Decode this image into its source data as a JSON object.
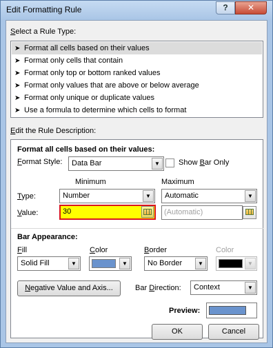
{
  "window": {
    "title": "Edit Formatting Rule",
    "help_label": "?",
    "close_label": "✕"
  },
  "rule_type": {
    "heading_prefix": "S",
    "heading_rest": "elect a Rule Type:",
    "arrow": "➤",
    "items": [
      "Format all cells based on their values",
      "Format only cells that contain",
      "Format only top or bottom ranked values",
      "Format only values that are above or below average",
      "Format only unique or duplicate values",
      "Use a formula to determine which cells to format"
    ],
    "selected_index": 0
  },
  "description": {
    "heading_prefix": "E",
    "heading_rest": "dit the Rule Description:",
    "subheading": "Format all cells based on their values:",
    "format_style_label_prefix": "F",
    "format_style_label_rest": "ormat Style:",
    "format_style_value": "Data Bar",
    "show_bar_only_prefix": "Show ",
    "show_bar_only_u": "B",
    "show_bar_only_rest": "ar Only",
    "show_bar_only_checked": false,
    "minimum_label": "Minimum",
    "maximum_label": "Maximum",
    "type_label_prefix": "T",
    "type_label_rest": "ype:",
    "min_type_value": "Number",
    "max_type_value": "Automatic",
    "value_label_prefix": "V",
    "value_label_rest": "alue:",
    "min_value": "30",
    "max_value_placeholder": "(Automatic)"
  },
  "bar_appearance": {
    "heading": "Bar Appearance:",
    "fill_label_prefix": "F",
    "fill_label_rest": "ill",
    "fill_value": "Solid Fill",
    "color_label_prefix": "C",
    "color_label_rest": "olor",
    "fill_color": "#6a93cd",
    "border_label_prefix": "B",
    "border_label_rest": "order",
    "border_value": "No Border",
    "border_color_label": "Color",
    "border_color": "#000000",
    "negative_button_prefix": "N",
    "negative_button_rest": "egative Value and Axis...",
    "bar_direction_label_prefix": "Bar ",
    "bar_direction_label_u": "D",
    "bar_direction_label_rest": "irection:",
    "bar_direction_value": "Context",
    "preview_label": "Preview:",
    "preview_color": "#6a93cd"
  },
  "footer": {
    "ok_label": "OK",
    "cancel_label": "Cancel"
  },
  "icons": {
    "dropdown": "▼",
    "ref_icon_name": "range-select-icon"
  }
}
